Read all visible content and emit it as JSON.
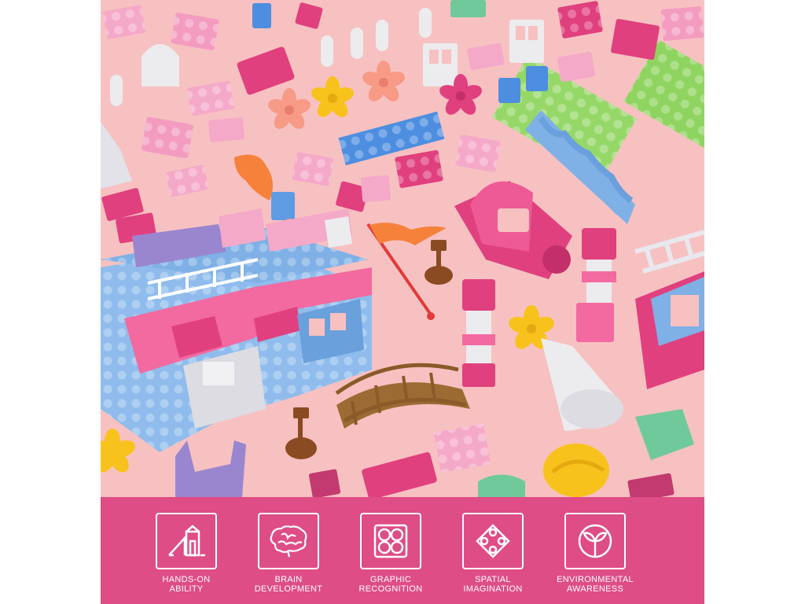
{
  "colors": {
    "background": "#f7c1c1",
    "banner": "#de4d86",
    "brick_pink": "#f5a9c8",
    "brick_magenta": "#e0407e",
    "brick_blue": "#7fb0e6",
    "brick_green": "#95d868",
    "brick_purple": "#9a86cf",
    "brick_white": "#ecebee",
    "flower_orange": "#f5813b",
    "flower_yellow": "#f8c21c",
    "bridge_brown": "#9c6b34"
  },
  "features": [
    {
      "line1": "HANDS-ON",
      "line2": "ABILITY",
      "icon": "playground-slide-icon"
    },
    {
      "line1": "BRAIN",
      "line2": "DEVELOPMENT",
      "icon": "brain-icon"
    },
    {
      "line1": "GRAPHIC",
      "line2": "RECOGNITION",
      "icon": "four-circles-icon"
    },
    {
      "line1": "SPATIAL",
      "line2": "IMAGINATION",
      "icon": "diamond-circles-icon"
    },
    {
      "line1": "ENVIRONMENTAL",
      "line2": "AWARENESS",
      "icon": "sprout-icon"
    }
  ]
}
